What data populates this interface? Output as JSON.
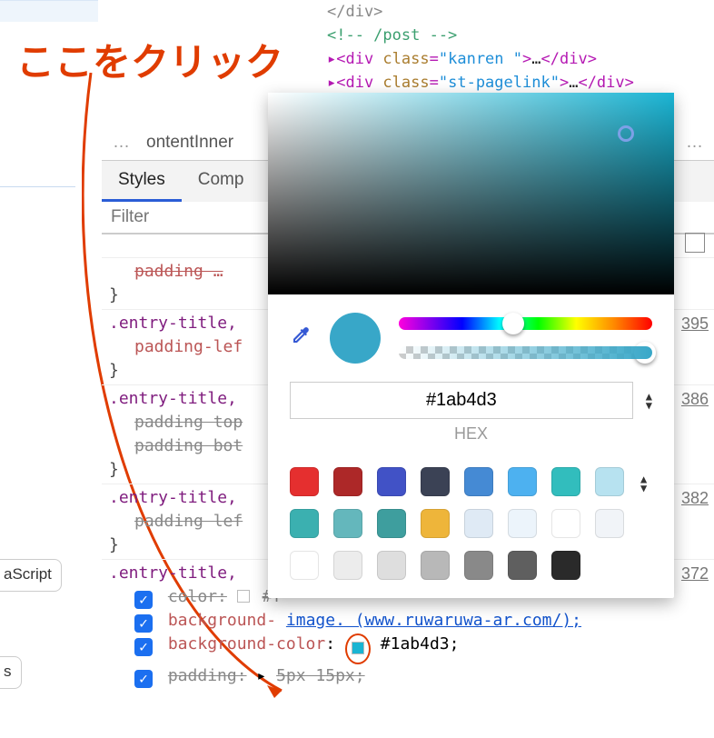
{
  "annotation": "ここをクリック",
  "code": {
    "line1_end": "</div>",
    "line2_comment": "<!-- /post -->",
    "line3": {
      "pre": "▸<div class=\"",
      "cl": "kanren ",
      "post": "\">…</div>"
    },
    "line4": {
      "pre": "▸<div class=\"",
      "cl": "st-pagelink",
      "post": "\">…</div>"
    }
  },
  "breadcrumb": {
    "dots": "…",
    "item": "ontentInner",
    "overflow": "…"
  },
  "tabs": {
    "styles": "Styles",
    "computed": "Comp"
  },
  "filter": {
    "placeholder": "Filter"
  },
  "linkrefs": {
    "a": "395",
    "b": "386",
    "c": "382",
    "d": "372"
  },
  "rules": {
    "r0_brace": "}",
    "r1_sel": ".entry-title,",
    "r1_prop": "padding-lef",
    "r2_sel": ".entry-title,",
    "r2_p1": "padding top",
    "r2_p2": "padding bot",
    "r3_sel": ".entry-title,",
    "r3_prop": "padding lef",
    "r4_sel": ".entry-title,",
    "r4_p1_k": "color:",
    "r4_p1_v": "#f",
    "r4_p2_k": "background-",
    "r4_p2_v": "image.    (www.ruwaruwa-ar.com/);",
    "r4_p3_k": "background-color",
    "r4_p3_v": "#1ab4d3;",
    "r4_p4_k": "padding:",
    "r4_p4_v": "5px 15px;"
  },
  "left_buttons": {
    "a": "aScript",
    "b": "s"
  },
  "colorpicker": {
    "hex": "#1ab4d3",
    "label": "HEX",
    "swatches_row1": [
      "#e52f2f",
      "#ad2828",
      "#4152c6",
      "#3b4255",
      "#458ad4",
      "#4db1f0",
      "#32bdbd",
      "#b7e2f0"
    ],
    "swatches_row2": [
      "#3bb0b0",
      "#64b7bc",
      "#3e9e9e",
      "#eeb53a",
      "#dfeaf5",
      "#ecf4fb",
      "#ffffff",
      "#f1f4f8"
    ],
    "swatches_row3": [
      "#ffffff",
      "#ececec",
      "#dedede",
      "#b8b8b8",
      "#898989",
      "#5f5f5f",
      "#2a2a2a"
    ]
  }
}
